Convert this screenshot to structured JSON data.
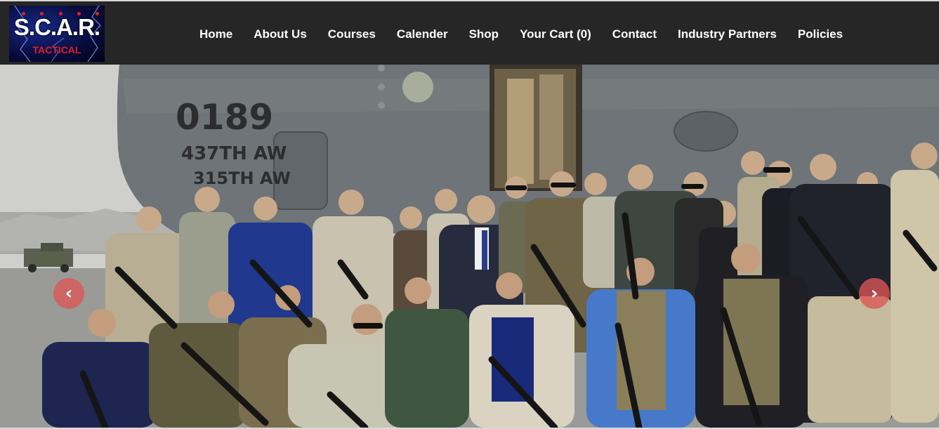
{
  "logo": {
    "title": "S.C.A.R.",
    "subtitle": "TACTICAL",
    "icon": "lightning-logo"
  },
  "nav": {
    "items": [
      {
        "label": "Home"
      },
      {
        "label": "About Us"
      },
      {
        "label": "Courses"
      },
      {
        "label": "Calender"
      },
      {
        "label": "Shop"
      },
      {
        "label": "Your Cart (0)"
      },
      {
        "label": "Contact"
      },
      {
        "label": "Industry Partners"
      },
      {
        "label": "Policies"
      }
    ]
  },
  "hero": {
    "aircraft_number": "0189",
    "aircraft_line1": "437TH AW",
    "aircraft_line2": "315TH AW",
    "prev_icon": "chevron-left-icon",
    "next_icon": "chevron-right-icon",
    "prev_glyph": "‹",
    "next_glyph": "›"
  },
  "colors": {
    "navbar": "#262626",
    "nav_text": "#ffffff",
    "arrow": "#db5656",
    "logo_red": "#e0202c"
  }
}
